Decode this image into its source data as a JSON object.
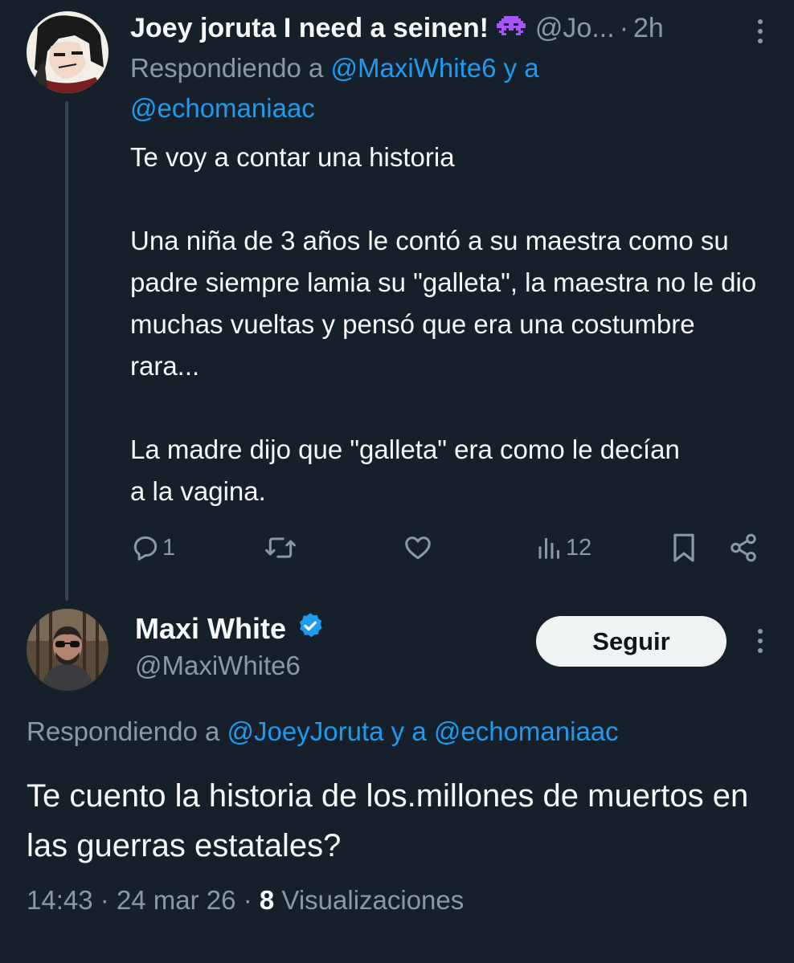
{
  "tweet1": {
    "display_name": "Joey joruta I need a seinen!",
    "name_emoji_icon": "alien-monster-icon",
    "handle": "@Jo...",
    "separator": "·",
    "time": "2h",
    "replying_prefix": "Respondiendo a",
    "replying_mention1": "@MaxiWhite6",
    "replying_joiner": "y a",
    "replying_mention2": "@echomaniaac",
    "body": [
      "Te voy a contar una historia",
      "Una niña de 3 años le contó a su maestra como su padre siempre lamia su \"galleta\", la maestra no le dio muchas vueltas y pensó que era una costumbre rara...",
      "La madre dijo que \"galleta\" era como le decían a la vagina."
    ],
    "actions": {
      "reply_count": "1",
      "retweet_count": "",
      "like_count": "",
      "views_count": "12"
    }
  },
  "tweet2": {
    "display_name": "Maxi White",
    "verified": true,
    "handle": "@MaxiWhite6",
    "follow_label": "Seguir",
    "replying_prefix": "Respondiendo a",
    "replying_mention1": "@JoeyJoruta",
    "replying_joiner": "y a",
    "replying_mention2": "@echomaniaac",
    "body": "Te cuento la historia de los.millones de muertos en las guerras estatales?",
    "time": "14:43",
    "separator": "·",
    "date": "24 mar 26",
    "views_count": "8",
    "views_label": "Visualizaciones"
  },
  "colors": {
    "background": "#15202b",
    "text": "#f7f9f9",
    "secondary": "#8b98a5",
    "accent": "#1d9bf0",
    "emoji": "#a855f7"
  }
}
